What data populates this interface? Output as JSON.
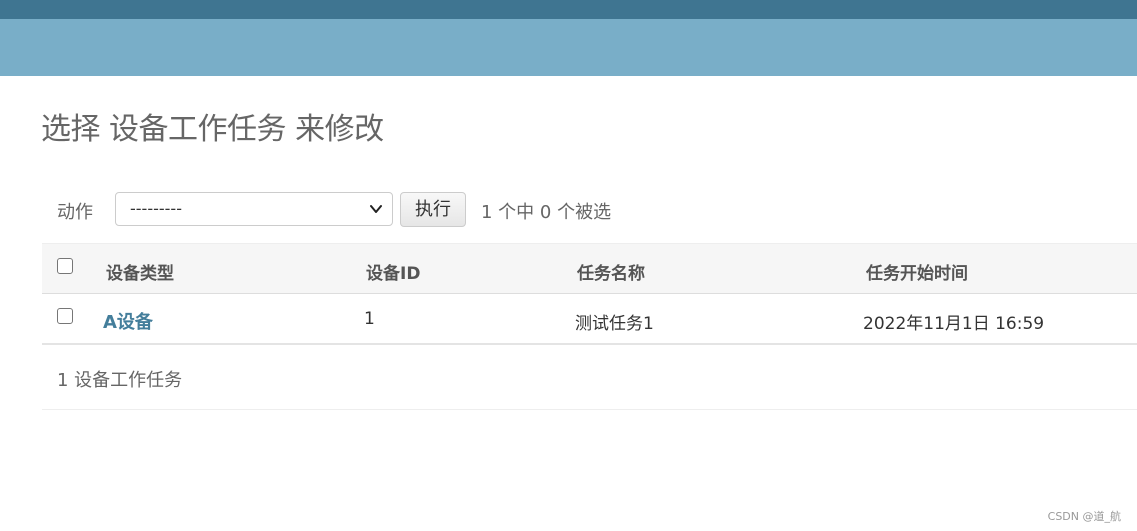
{
  "page": {
    "title": "选择 设备工作任务 来修改"
  },
  "actions": {
    "label": "动作",
    "select_value": "---------",
    "go_label": "执行",
    "selected_text": "1 个中 0 个被选"
  },
  "table": {
    "headers": [
      "设备类型",
      "设备ID",
      "任务名称",
      "任务开始时间"
    ],
    "rows": [
      {
        "device_type": "A设备",
        "device_id": "1",
        "task_name": "测试任务1",
        "start_time": "2022年11月1日 16:59"
      }
    ]
  },
  "paginator": {
    "count_text": "1 设备工作任务"
  },
  "watermark": "CSDN @道_航",
  "colors": {
    "header_dark": "#3f7591",
    "header_light": "#79aec8",
    "link": "#447e9b"
  }
}
